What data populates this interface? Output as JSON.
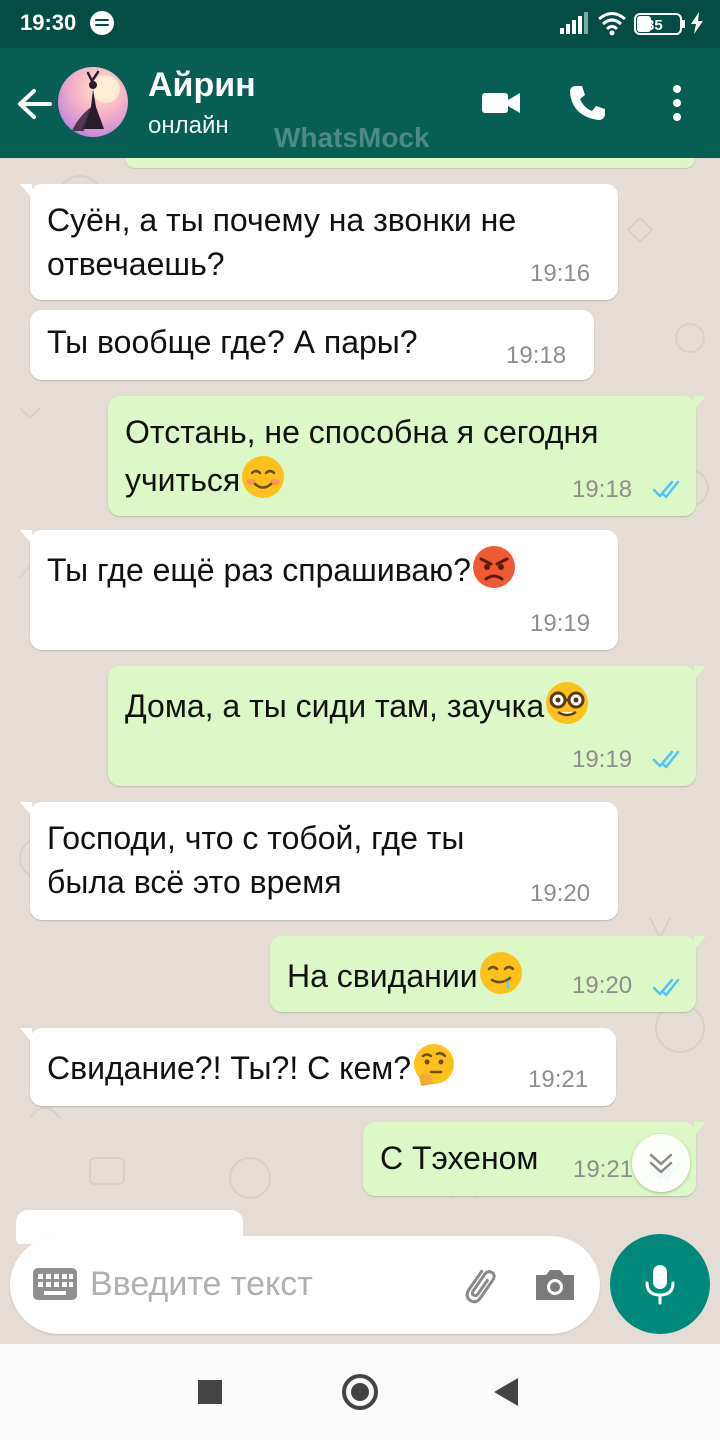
{
  "status_bar": {
    "time": "19:30",
    "battery_level": "35",
    "icons": [
      "spotify-icon",
      "signal-icon",
      "wifi-icon",
      "battery-icon",
      "charging-icon"
    ]
  },
  "header": {
    "contact_name": "Айрин",
    "contact_status": "онлайн",
    "watermark": "WhatsMock",
    "background": "#075e54",
    "icons": [
      "back-arrow-icon",
      "video-call-icon",
      "phone-icon",
      "more-vert-icon"
    ]
  },
  "messages": [
    {
      "direction": "in",
      "lines": [
        "Суён, а ты почему на звонки не",
        "отвечаешь?"
      ],
      "time": "19:16"
    },
    {
      "direction": "in",
      "lines": [
        "Ты вообще где? А пары?"
      ],
      "time": "19:18"
    },
    {
      "direction": "out",
      "lines": [
        "Отстань, не способна я сегодня",
        "учиться"
      ],
      "emoji": "smiling-face-emoji",
      "time": "19:18",
      "read": true
    },
    {
      "direction": "in",
      "lines": [
        "Ты где ещё раз спрашиваю?"
      ],
      "emoji": "angry-face-emoji",
      "time": "19:19"
    },
    {
      "direction": "out",
      "lines": [
        "Дома, а ты сиди там, заучка"
      ],
      "emoji": "nerd-face-emoji",
      "time": "19:19",
      "read": true
    },
    {
      "direction": "in",
      "lines": [
        "Господи, что с тобой, где ты",
        "была всё это время"
      ],
      "time": "19:20"
    },
    {
      "direction": "out",
      "lines": [
        "На свидании"
      ],
      "emoji": "drooling-face-emoji",
      "time": "19:20",
      "read": true
    },
    {
      "direction": "in",
      "lines": [
        "Свидание?! Ты?! С кем?"
      ],
      "emoji": "thinking-face-emoji",
      "time": "19:21"
    },
    {
      "direction": "out",
      "lines": [
        "С Тэхеном"
      ],
      "time": "19:21",
      "read": true
    }
  ],
  "composer": {
    "placeholder": "Введите текст",
    "icons": [
      "keyboard-icon",
      "paperclip-icon",
      "camera-icon",
      "microphone-icon"
    ]
  },
  "colors": {
    "incoming_bubble": "#ffffff",
    "outgoing_bubble": "#dcf8c6",
    "read_ticks": "#4fc3f7",
    "mic_button": "#00897b"
  },
  "nav_bar": {
    "icons": [
      "recents-icon",
      "home-icon",
      "back-icon"
    ]
  }
}
